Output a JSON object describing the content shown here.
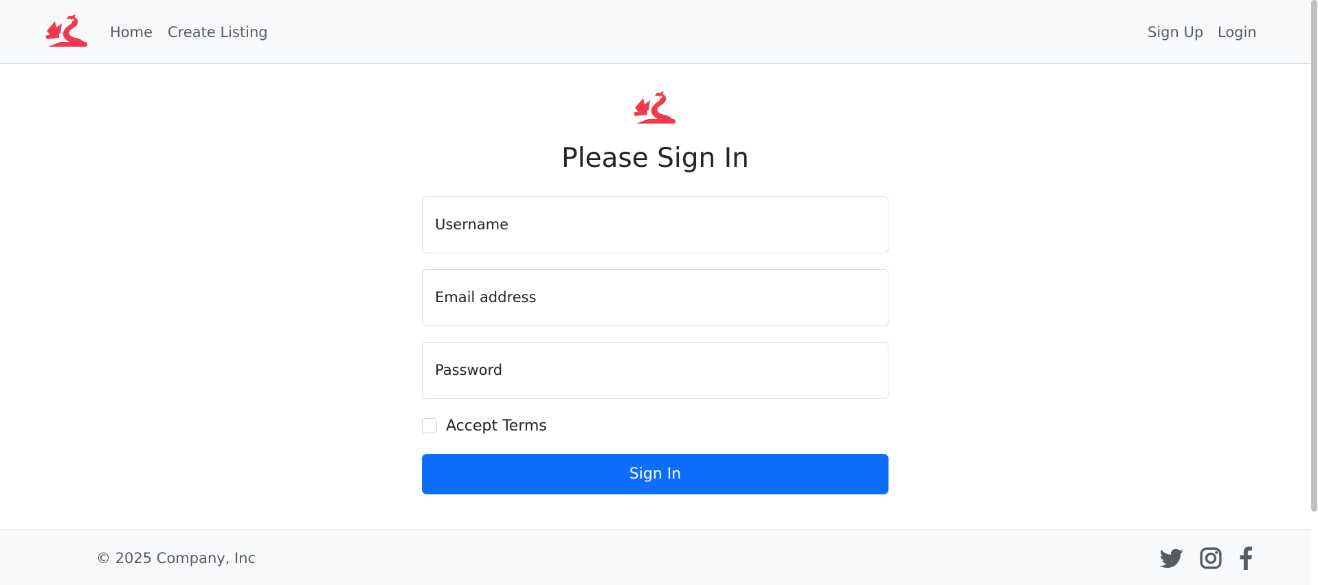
{
  "navbar": {
    "logo_icon": "dragon-logo-icon",
    "left_links": [
      "Home",
      "Create Listing"
    ],
    "right_links": [
      "Sign Up",
      "Login"
    ]
  },
  "main": {
    "logo_icon": "dragon-logo-icon",
    "title": "Please Sign In",
    "fields": {
      "username": {
        "label": "Username",
        "value": ""
      },
      "email": {
        "label": "Email address",
        "value": ""
      },
      "password": {
        "label": "Password",
        "value": ""
      }
    },
    "accept_terms": {
      "label": "Accept Terms",
      "checked": false
    },
    "submit_label": "Sign In"
  },
  "footer": {
    "copyright": "© 2025 Company, Inc",
    "social_icons": [
      "twitter-icon",
      "instagram-icon",
      "facebook-icon"
    ]
  },
  "colors": {
    "brand_red": "#f0394f",
    "primary_blue": "#0d6efd",
    "nav_bg": "#f8f9fa",
    "link_gray": "#595c5f"
  }
}
